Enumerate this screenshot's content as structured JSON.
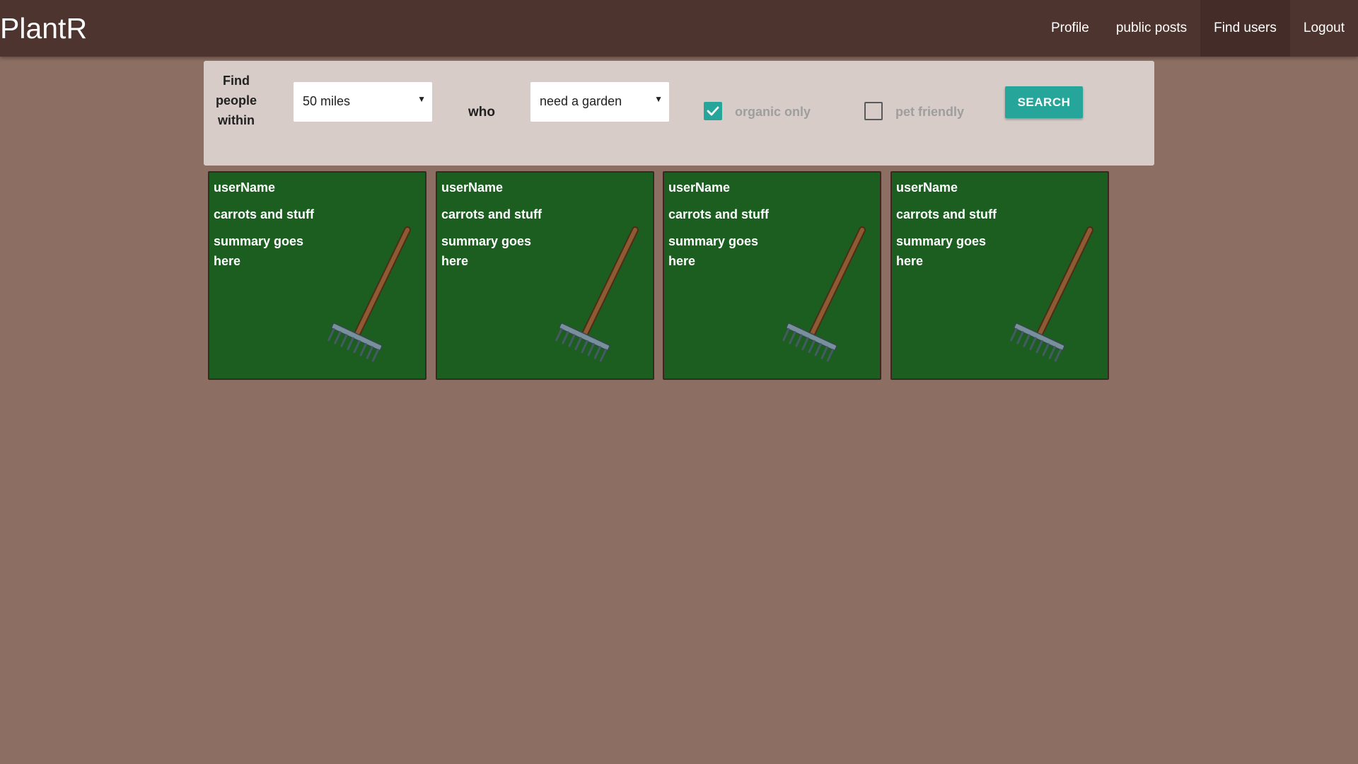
{
  "brand": "PlantR",
  "nav": [
    "Profile",
    "public posts",
    "Find users",
    "Logout"
  ],
  "search": {
    "find_label": "Find people within",
    "distance": "50 miles",
    "who_label": "who",
    "need": "need a garden",
    "organic_label": "organic only",
    "organic_checked": true,
    "pet_label": "pet friendly",
    "pet_checked": false,
    "button_label": "SEARCH"
  },
  "cards": [
    {
      "username": "userName",
      "title": "carrots and stuff",
      "summary": "summary goes here",
      "icon": "rake-icon"
    },
    {
      "username": "userName",
      "title": "carrots and stuff",
      "summary": "summary goes here",
      "icon": "rake-icon"
    },
    {
      "username": "userName",
      "title": "carrots and stuff",
      "summary": "summary goes here",
      "icon": "rake-icon"
    },
    {
      "username": "userName",
      "title": "carrots and stuff",
      "summary": "summary goes here",
      "icon": "rake-icon"
    }
  ],
  "colors": {
    "page_bg": "#8d6e63",
    "navbar": "#4e342e",
    "panel": "#d7ccc8",
    "accent": "#26a69a",
    "card": "#1b5e20"
  }
}
